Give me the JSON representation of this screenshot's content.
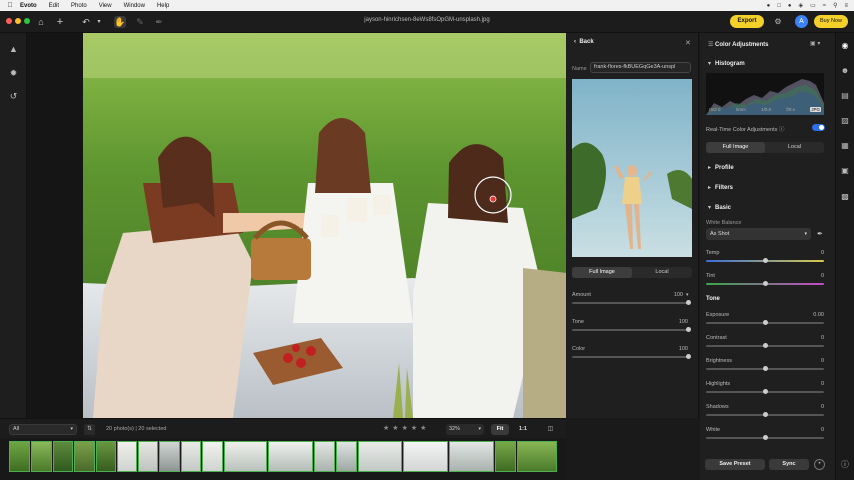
{
  "menubar": {
    "items": [
      "Evoto",
      "Edit",
      "Photo",
      "View",
      "Window",
      "Help"
    ]
  },
  "toolbar": {
    "filename": "jayson-hinrichsen-8eWs8fsOpGM-unsplash.jpg",
    "export_label": "Export",
    "avatar_initial": "A",
    "buy_now_label": "Buy Now"
  },
  "preset_panel": {
    "back_label": "Back",
    "name_label": "Name",
    "name_value": "frank-flores-fkBUEGqGe3A-unspl",
    "tabs": [
      {
        "label": "Full Image",
        "active": true
      },
      {
        "label": "Local",
        "active": false
      }
    ],
    "sliders": [
      {
        "label": "Amount",
        "value": "100"
      },
      {
        "label": "Tone",
        "value": "100"
      },
      {
        "label": "Color",
        "value": "100"
      }
    ]
  },
  "adjustments": {
    "title": "Color Adjustments",
    "histogram_label": "Histogram",
    "histogram_info": [
      "ISO 0",
      "0mm",
      "1/0.0",
      "f/0.x",
      "JPG"
    ],
    "realtime_label": "Real-Time Color Adjustments",
    "realtime_on": true,
    "tabs": [
      {
        "label": "Full Image",
        "active": true
      },
      {
        "label": "Local",
        "active": false
      }
    ],
    "sections": [
      "Profile",
      "Filters",
      "Basic"
    ],
    "white_balance_label": "White Balance",
    "white_balance_value": "As Shot",
    "wb_sliders": [
      {
        "label": "Temp",
        "value": "0"
      },
      {
        "label": "Tint",
        "value": "0"
      }
    ],
    "tone_label": "Tone",
    "tone_sliders": [
      {
        "label": "Exposure",
        "value": "0.00"
      },
      {
        "label": "Contrast",
        "value": "0"
      },
      {
        "label": "Brightness",
        "value": "0"
      },
      {
        "label": "Highlights",
        "value": "0"
      },
      {
        "label": "Shadows",
        "value": "0"
      },
      {
        "label": "White",
        "value": "0"
      }
    ],
    "save_preset_label": "Save Preset",
    "sync_label": "Sync"
  },
  "filmbar": {
    "filter_value": "All",
    "count_text": "20 photo(s) | 20 selected",
    "zoom_value": "32%",
    "fit_label": "Fit",
    "one_to_one_label": "1:1",
    "rating_stars": 5
  },
  "colors": {
    "accent_yellow": "#f4d02a",
    "accent_blue": "#2f6fea",
    "selection_green": "#4caf50"
  }
}
